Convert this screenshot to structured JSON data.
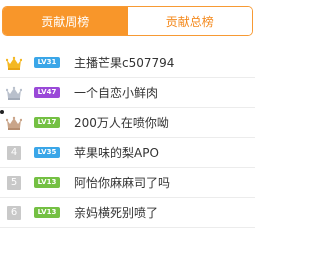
{
  "tabs": [
    {
      "label": "贡献周榜",
      "active": true
    },
    {
      "label": "贡献总榜",
      "active": false
    }
  ],
  "rows": [
    {
      "rank_icon": "gold-crown-icon",
      "rank": "",
      "level": "LV31",
      "level_color": "#3aa6e8",
      "name": "主播芒果c507794"
    },
    {
      "rank_icon": "silver-crown-icon",
      "rank": "",
      "level": "LV47",
      "level_color": "#9a49d8",
      "name": "一个自恋小鲜肉"
    },
    {
      "rank_icon": "bronze-crown-icon",
      "rank": "",
      "level": "LV17",
      "level_color": "#74c043",
      "name": "200万人在喷你呦"
    },
    {
      "rank_icon": "",
      "rank": "4",
      "level": "LV35",
      "level_color": "#3aa6e8",
      "name": "苹果味的梨APO"
    },
    {
      "rank_icon": "",
      "rank": "5",
      "level": "LV13",
      "level_color": "#74c043",
      "name": "阿怡你麻麻司了吗"
    },
    {
      "rank_icon": "",
      "rank": "6",
      "level": "LV13",
      "level_color": "#74c043",
      "name": "亲妈横死别喷了"
    }
  ],
  "colors": {
    "accent": "#f8962a",
    "gold": "#f4b823",
    "silver": "#b9c0cc",
    "bronze": "#c9a58a"
  }
}
